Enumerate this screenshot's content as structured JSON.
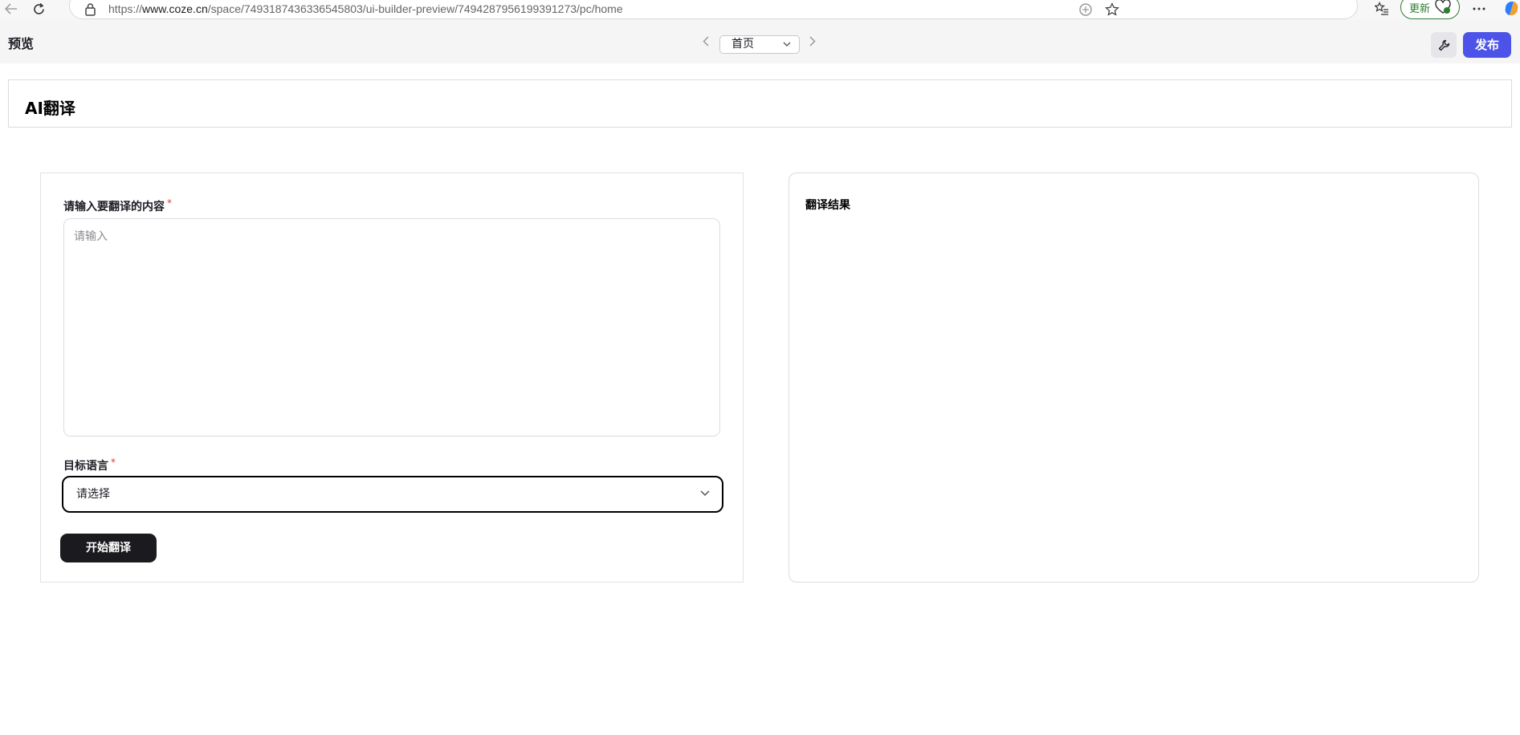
{
  "browser": {
    "url_prefix": "https://",
    "url_host": "www.coze.cn",
    "url_path": "/space/7493187436336545803/ui-builder-preview/7494287956199391273/pc/home",
    "update_label": "更新",
    "back_icon": "arrow-left-icon",
    "reload_icon": "reload-icon",
    "more_icon": "more-horizontal-icon"
  },
  "toolbar": {
    "title": "预览",
    "page_selector": {
      "selected": "首页"
    },
    "publish_label": "发布"
  },
  "header": {
    "title": "AI翻译"
  },
  "form": {
    "content_label": "请输入要翻译的内容",
    "required_mark": "*",
    "content_placeholder": "请输入",
    "language_label": "目标语言",
    "language_placeholder": "请选择",
    "submit_label": "开始翻译"
  },
  "result": {
    "title": "翻译结果"
  },
  "colors": {
    "accent": "#4d53e8",
    "primary_button": "#1b1b1f",
    "required": "#e53935",
    "update_green": "#2f7d32"
  }
}
